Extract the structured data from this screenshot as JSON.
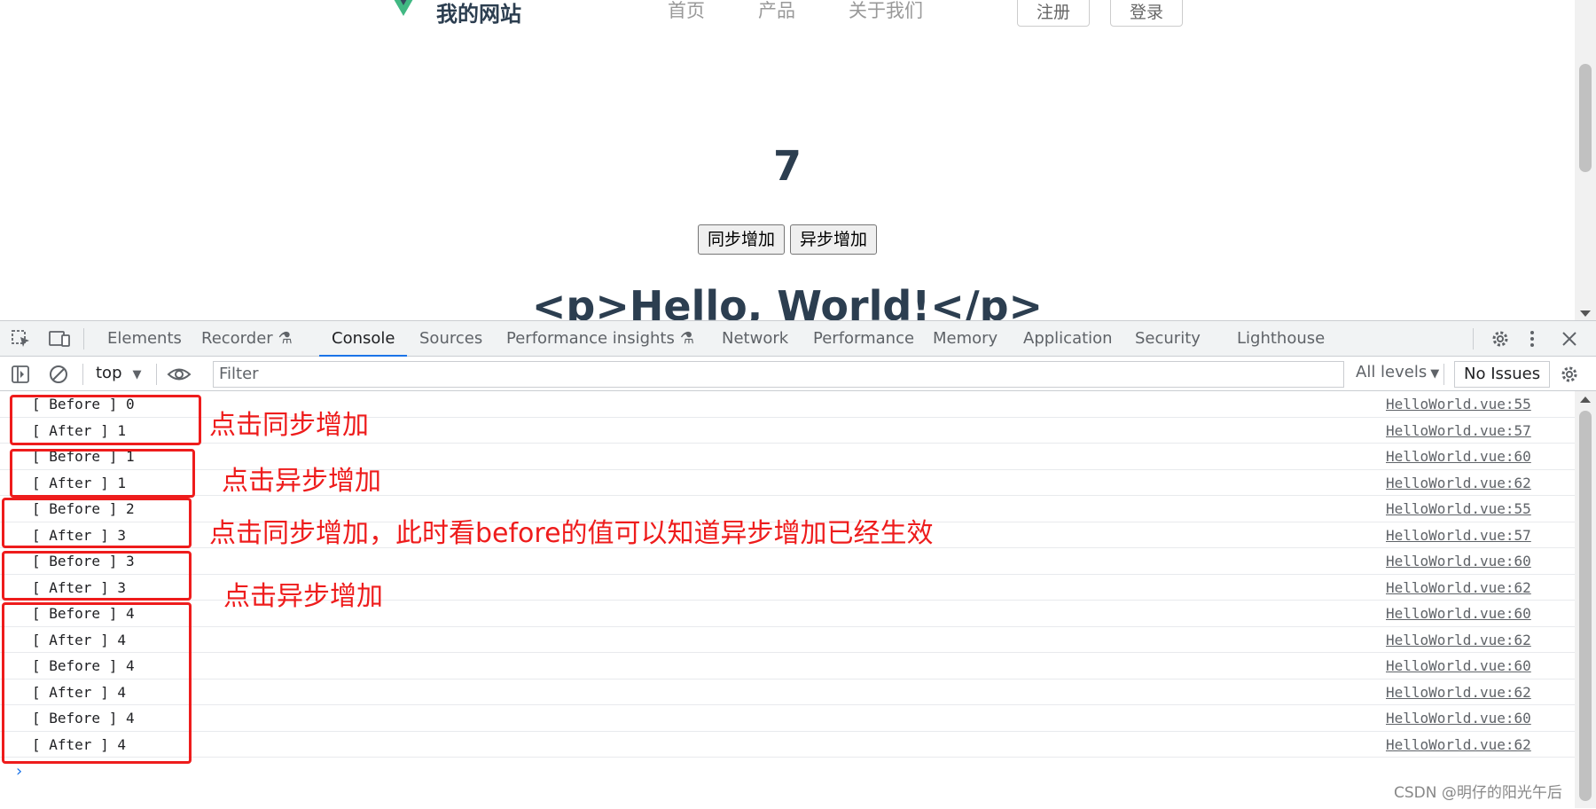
{
  "page": {
    "site_name": "我的网站",
    "nav": [
      "首页",
      "产品",
      "关于我们"
    ],
    "register_label": "注册",
    "login_label": "登录",
    "counter": "7",
    "sync_button": "同步增加",
    "async_button": "异步增加",
    "hello_text": "<p>Hello, World!</p>"
  },
  "devtools": {
    "tabs": [
      "Elements",
      "Recorder",
      "Console",
      "Sources",
      "Performance insights",
      "Network",
      "Performance",
      "Memory",
      "Application",
      "Security",
      "Lighthouse"
    ],
    "active_tab": "Console",
    "context": "top",
    "filter_placeholder": "Filter",
    "levels": "All levels",
    "issues": "No Issues"
  },
  "console": {
    "rows": [
      {
        "msg": "[ Before ] 0",
        "src": "HelloWorld.vue:55"
      },
      {
        "msg": "[ After ] 1",
        "src": "HelloWorld.vue:57"
      },
      {
        "msg": "[ Before ] 1",
        "src": "HelloWorld.vue:60"
      },
      {
        "msg": "[ After ] 1",
        "src": "HelloWorld.vue:62"
      },
      {
        "msg": "[ Before ] 2",
        "src": "HelloWorld.vue:55"
      },
      {
        "msg": "[ After ] 3",
        "src": "HelloWorld.vue:57"
      },
      {
        "msg": "[ Before ] 3",
        "src": "HelloWorld.vue:60"
      },
      {
        "msg": "[ After ] 3",
        "src": "HelloWorld.vue:62"
      },
      {
        "msg": "[ Before ] 4",
        "src": "HelloWorld.vue:60"
      },
      {
        "msg": "[ After ] 4",
        "src": "HelloWorld.vue:62"
      },
      {
        "msg": "[ Before ] 4",
        "src": "HelloWorld.vue:60"
      },
      {
        "msg": "[ After ] 4",
        "src": "HelloWorld.vue:62"
      },
      {
        "msg": "[ Before ] 4",
        "src": "HelloWorld.vue:60"
      },
      {
        "msg": "[ After ] 4",
        "src": "HelloWorld.vue:62"
      }
    ],
    "prompt": "›"
  },
  "annotations": {
    "note1": "点击同步增加",
    "note2": "点击异步增加",
    "note3": "点击同步增加，此时看before的值可以知道异步增加已经生效",
    "note4": "点击异步增加",
    "color": "#ee1c1c"
  },
  "watermark": "CSDN @明仔的阳光午后"
}
